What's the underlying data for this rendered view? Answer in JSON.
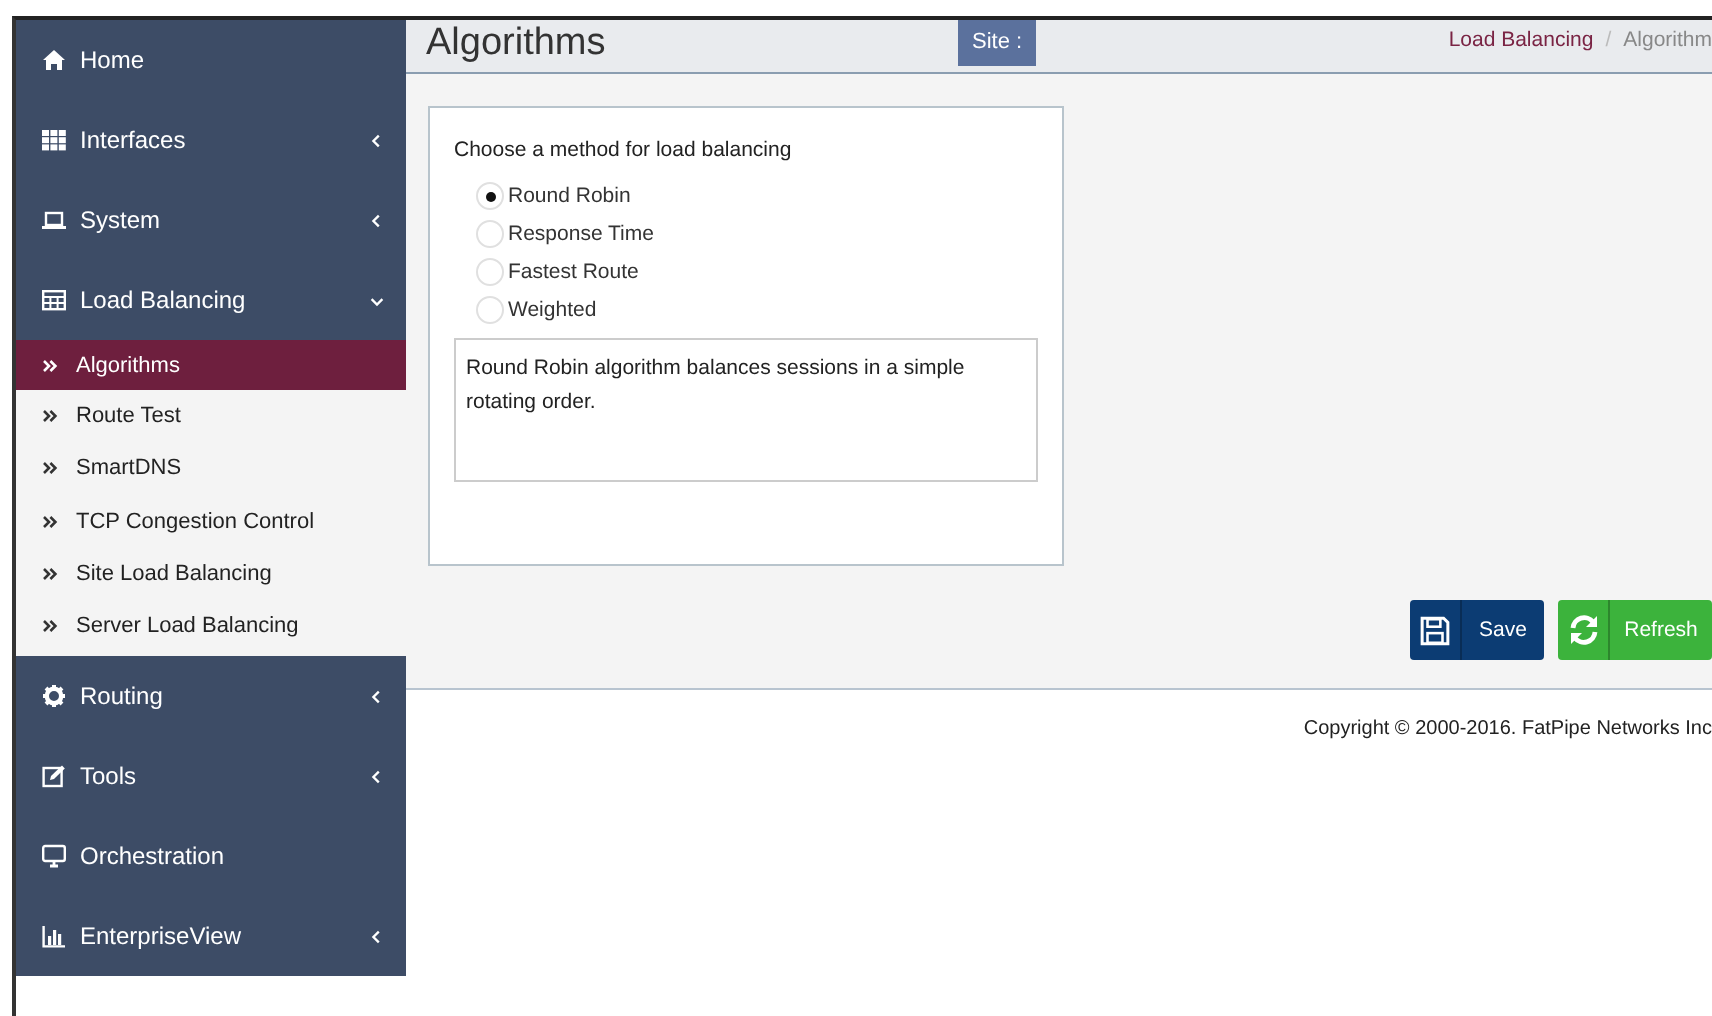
{
  "sidebar": {
    "items": [
      {
        "label": "Home",
        "kind": "link"
      },
      {
        "label": "Interfaces",
        "kind": "menu",
        "expanded": false
      },
      {
        "label": "System",
        "kind": "menu",
        "expanded": false
      },
      {
        "label": "Load Balancing",
        "kind": "menu",
        "expanded": true,
        "children": [
          {
            "label": "Algorithms",
            "selected": true
          },
          {
            "label": "Route Test",
            "selected": false
          },
          {
            "label": "SmartDNS",
            "selected": false
          },
          {
            "label": "TCP Congestion Control",
            "selected": false
          },
          {
            "label": "Site Load Balancing",
            "selected": false
          },
          {
            "label": "Server Load Balancing",
            "selected": false
          }
        ]
      },
      {
        "label": "Routing",
        "kind": "menu",
        "expanded": false
      },
      {
        "label": "Tools",
        "kind": "menu",
        "expanded": false
      },
      {
        "label": "Orchestration",
        "kind": "link"
      },
      {
        "label": "EnterpriseView",
        "kind": "menu",
        "expanded": false
      }
    ]
  },
  "header": {
    "title": "Algorithms",
    "site_label": "Site :",
    "breadcrumb": [
      "Load Balancing",
      "Algorithm"
    ],
    "breadcrumb_separator": "/"
  },
  "card": {
    "heading": "Choose a method for load balancing",
    "options": [
      {
        "label": "Round Robin",
        "selected": true
      },
      {
        "label": "Response Time",
        "selected": false
      },
      {
        "label": "Fastest Route",
        "selected": false
      },
      {
        "label": "Weighted",
        "selected": false
      }
    ],
    "description": "Round Robin algorithm balances sessions in a simple rotating order."
  },
  "buttons": [
    {
      "label": "Save",
      "kind": "save"
    },
    {
      "label": "Refresh",
      "kind": "refresh"
    }
  ],
  "footer": "Copyright © 2000-2016. FatPipe Networks Inc"
}
